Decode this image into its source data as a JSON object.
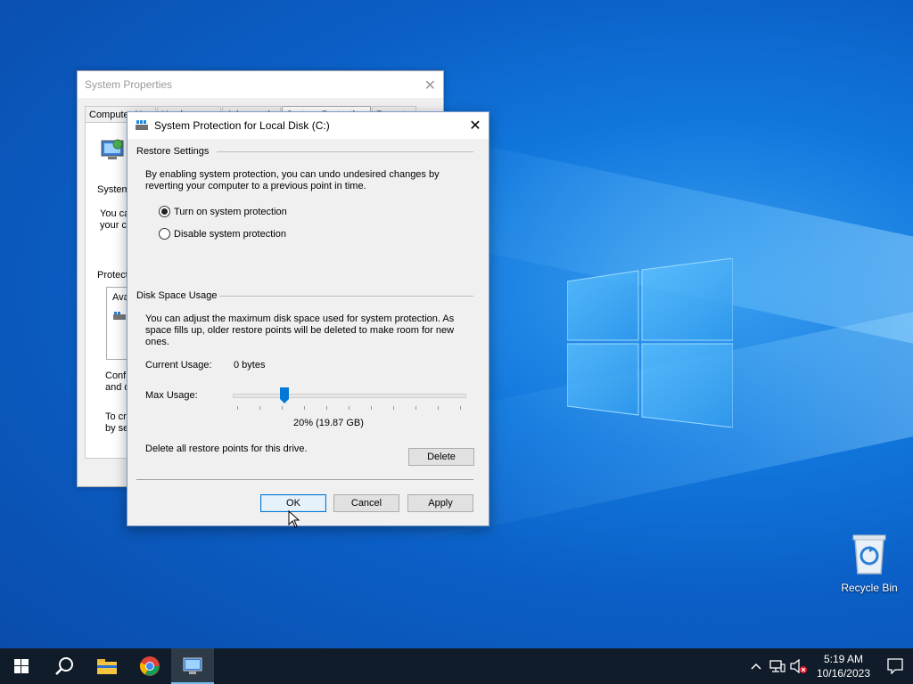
{
  "desktop": {
    "recycle_bin_label": "Recycle Bin"
  },
  "system_properties": {
    "title": "System Properties",
    "tabs": [
      "Computer Name",
      "Hardware",
      "Advanced",
      "System Protection",
      "Remote"
    ],
    "fragments": [
      "System",
      "You ca",
      "your co",
      "Protecti",
      "Ava",
      "Confi",
      "and d",
      "To cr",
      "by se"
    ]
  },
  "dialog": {
    "title": "System Protection for Local Disk (C:)",
    "restore_settings": {
      "header": "Restore Settings",
      "description_line1": "By enabling system protection, you can undo undesired changes by",
      "description_line2": "reverting your computer to a previous point in time.",
      "option_on": "Turn on system protection",
      "option_off": "Disable system protection",
      "selected": "on"
    },
    "disk_space": {
      "header": "Disk Space Usage",
      "description_line1": "You can adjust the maximum disk space used for system protection. As",
      "description_line2": "space fills up, older restore points will be deleted to make room for new",
      "description_line3": "ones.",
      "current_usage_label": "Current Usage:",
      "current_usage_value": "0 bytes",
      "max_usage_label": "Max Usage:",
      "max_usage_percent": 20,
      "max_usage_text": "20% (19.87 GB)"
    },
    "delete_text": "Delete all restore points for this drive.",
    "buttons": {
      "delete": "Delete",
      "ok": "OK",
      "cancel": "Cancel",
      "apply": "Apply"
    }
  },
  "taskbar": {
    "apps": [
      "start-icon",
      "search-icon",
      "file-explorer-icon",
      "chrome-icon",
      "system-properties-icon"
    ],
    "time": "5:19 AM",
    "date": "10/16/2023"
  },
  "colors": {
    "accent": "#0078d7",
    "taskbar": "#101c29"
  }
}
